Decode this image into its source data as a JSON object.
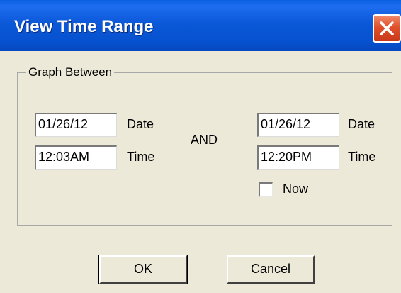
{
  "window": {
    "title": "View Time Range",
    "close_icon": "close-icon",
    "accent_color": "#0b58d8",
    "close_color": "#e0502c"
  },
  "group": {
    "label": "Graph Between",
    "start": {
      "date_value": "01/26/12",
      "date_label": "Date",
      "time_value": "12:03AM",
      "time_label": "Time"
    },
    "connector": "AND",
    "end": {
      "date_value": "01/26/12",
      "date_label": "Date",
      "time_value": "12:20PM",
      "time_label": "Time"
    },
    "now": {
      "label": "Now",
      "checked": false
    }
  },
  "buttons": {
    "ok": "OK",
    "cancel": "Cancel"
  }
}
